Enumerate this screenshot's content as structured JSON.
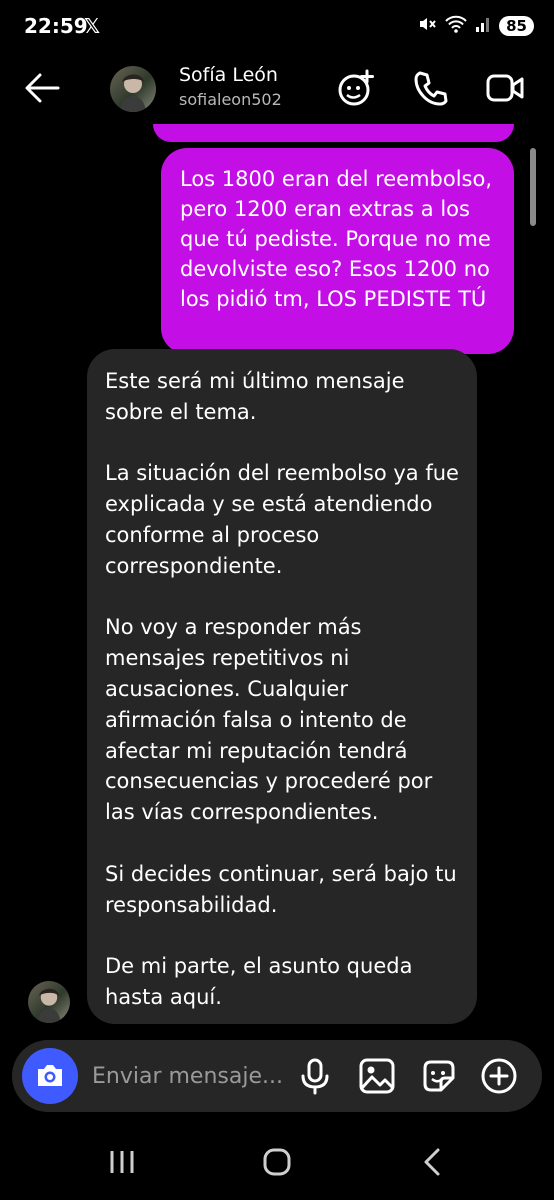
{
  "status_bar": {
    "time": "22:59",
    "x_label": "𝕏",
    "battery": "85",
    "icons": [
      "mute-icon",
      "wifi-icon",
      "signal-icon",
      "battery-icon"
    ]
  },
  "header": {
    "contact_name": "Sofía León",
    "contact_handle": "sofialeon502",
    "icons": [
      "back-arrow-icon",
      "add-to-group-icon",
      "phone-call-icon",
      "video-call-icon"
    ]
  },
  "messages": {
    "outgoing": "Los 1800 eran del reembolso, pero 1200 eran extras a los que tú pediste. Porque no me devolviste eso? Esos 1200 no los pidió tm, LOS PEDISTE TÚ",
    "incoming": {
      "line_1": "Este será mi último mensaje sobre el tema.",
      "line_2": "La situación del reembolso ya fue explicada y se está atendiendo conforme al proceso correspondiente.",
      "line_3": "No voy a responder más mensajes repetitivos ni acusaciones. Cualquier afirmación falsa o intento de afectar mi reputación tendrá consecuencias y procederé por las vías correspondientes.",
      "line_4": "Si decides continuar, será bajo tu responsabilidad.",
      "line_5": "De mi parte, el asunto queda hasta aquí."
    }
  },
  "composer": {
    "placeholder": "Enviar mensaje...",
    "icons": [
      "camera-icon",
      "microphone-icon",
      "gallery-icon",
      "sticker-icon",
      "plus-icon"
    ]
  },
  "colors": {
    "outgoing_bubble": "#c30fe6",
    "incoming_bubble": "#262626",
    "camera_button": "#3f5bff",
    "background": "#000000"
  },
  "nav_bar": {
    "icons": [
      "recents-icon",
      "home-icon",
      "back-icon"
    ]
  }
}
